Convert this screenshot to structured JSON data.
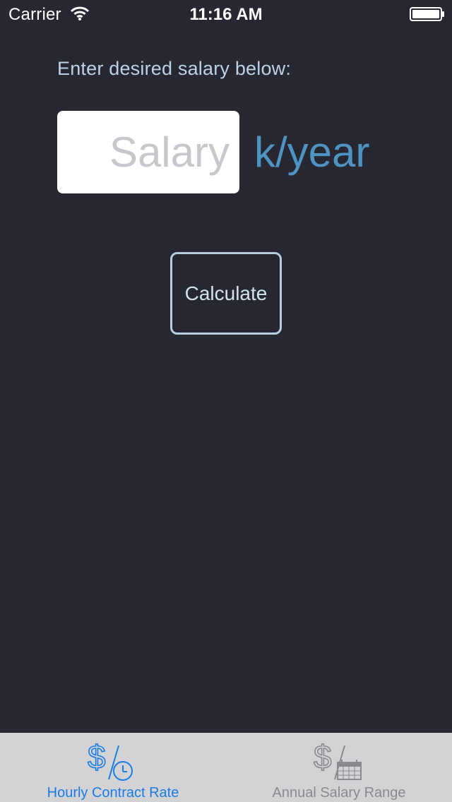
{
  "status_bar": {
    "carrier": "Carrier",
    "time": "11:16 AM",
    "wifi_icon": "wifi-icon",
    "battery_icon": "battery-icon"
  },
  "main": {
    "prompt": "Enter desired salary below:",
    "salary_input": {
      "value": "",
      "placeholder": "Salary"
    },
    "unit_label": "k/year",
    "calculate_label": "Calculate"
  },
  "tab_bar": {
    "tabs": [
      {
        "label": "Hourly Contract Rate",
        "icon": "dollar-clock-icon",
        "selected": true
      },
      {
        "label": "Annual Salary Range",
        "icon": "dollar-calendar-icon",
        "selected": false
      }
    ]
  },
  "colors": {
    "background": "#262730",
    "prompt_text": "#bdd2e6",
    "unit_text": "#4e93c1",
    "button_border": "#b8cde0",
    "tab_bar_bg": "#d3d3d6",
    "tab_selected": "#1a7be3",
    "tab_unselected": "#8a8a8e"
  }
}
